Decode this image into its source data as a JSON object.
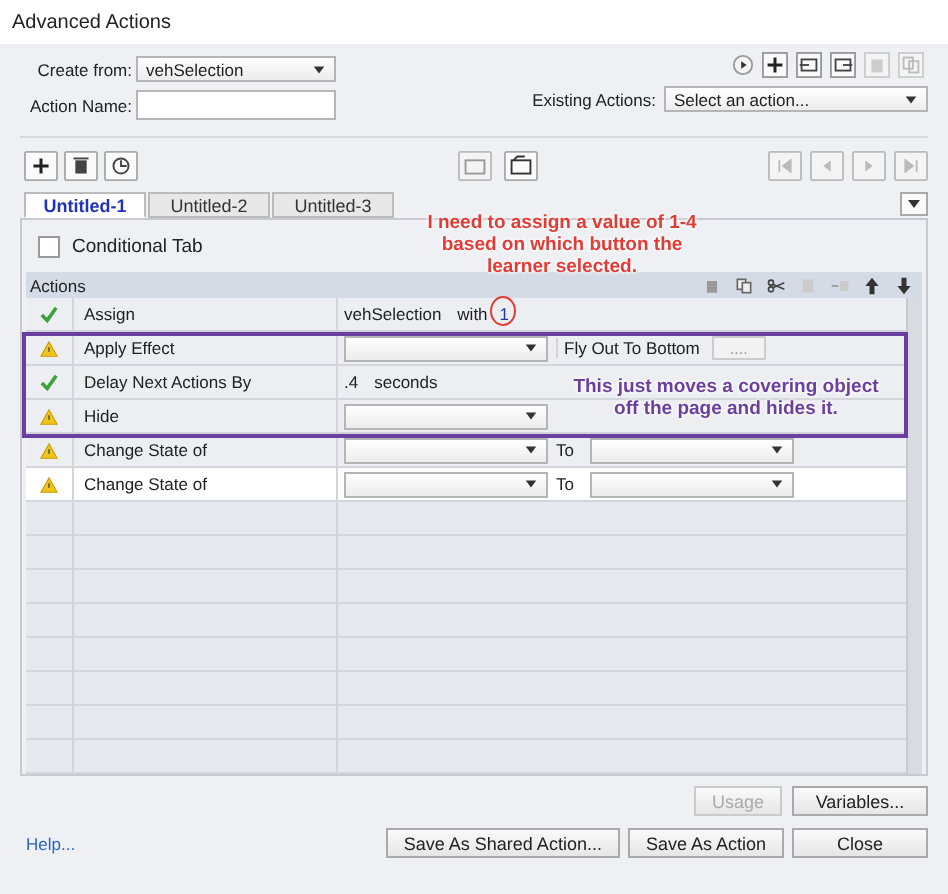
{
  "window": {
    "title": "Advanced Actions"
  },
  "create_from": {
    "label": "Create from:",
    "value": "vehSelection"
  },
  "action_name": {
    "label": "Action Name:"
  },
  "existing_actions": {
    "label": "Existing Actions:",
    "value": "Select an action..."
  },
  "tabs": [
    {
      "label": "Untitled-1",
      "selected": true
    },
    {
      "label": "Untitled-2",
      "selected": false
    },
    {
      "label": "Untitled-3",
      "selected": false
    }
  ],
  "conditional_tab": {
    "label": "Conditional Tab",
    "checked": false
  },
  "actions": {
    "header": "Actions",
    "rows": [
      {
        "warning": false,
        "action": "Assign",
        "kind": "assign",
        "selected": false,
        "target": "vehSelection",
        "word": "with",
        "value": "1"
      },
      {
        "warning": true,
        "action": "Apply Effect",
        "kind": "effect",
        "selected": false,
        "effect": "Fly Out To Bottom",
        "button": "...."
      },
      {
        "warning": false,
        "action": "Delay Next Actions By",
        "kind": "delay",
        "selected": false,
        "value": ".4",
        "unit": "seconds"
      },
      {
        "warning": true,
        "action": "Hide",
        "kind": "select",
        "selected": false
      },
      {
        "warning": true,
        "action": "Change State of",
        "kind": "state",
        "selected": false,
        "to": "To"
      },
      {
        "warning": true,
        "action": "Change State of",
        "kind": "state",
        "selected": true,
        "to": "To"
      }
    ]
  },
  "annotations": [
    {
      "kind": "callout",
      "text": "I need to assign a value of 1-4 based on which button the learner selected.",
      "color": "#e23b35"
    },
    {
      "kind": "callout",
      "text": "This just moves a covering object off the page and hides it.",
      "color": "#6b3fa0"
    }
  ],
  "buttons": [
    {
      "label": "Usage",
      "disabled": true
    },
    {
      "label": "Variables...",
      "disabled": false
    }
  ],
  "help": "Help...",
  "footer_buttons": [
    "Save As Shared Action...",
    "Save As Action",
    "Close"
  ]
}
